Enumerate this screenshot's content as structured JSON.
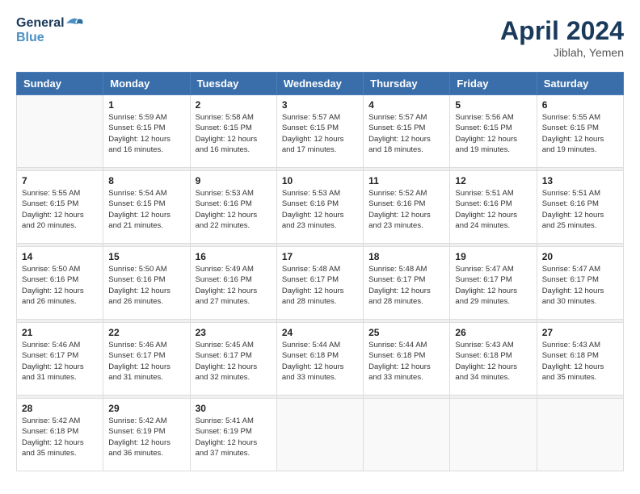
{
  "header": {
    "logo_line1": "General",
    "logo_line2": "Blue",
    "month": "April 2024",
    "location": "Jiblah, Yemen"
  },
  "weekdays": [
    "Sunday",
    "Monday",
    "Tuesday",
    "Wednesday",
    "Thursday",
    "Friday",
    "Saturday"
  ],
  "weeks": [
    [
      {
        "day": "",
        "sunrise": "",
        "sunset": "",
        "daylight": ""
      },
      {
        "day": "1",
        "sunrise": "Sunrise: 5:59 AM",
        "sunset": "Sunset: 6:15 PM",
        "daylight": "Daylight: 12 hours and 16 minutes."
      },
      {
        "day": "2",
        "sunrise": "Sunrise: 5:58 AM",
        "sunset": "Sunset: 6:15 PM",
        "daylight": "Daylight: 12 hours and 16 minutes."
      },
      {
        "day": "3",
        "sunrise": "Sunrise: 5:57 AM",
        "sunset": "Sunset: 6:15 PM",
        "daylight": "Daylight: 12 hours and 17 minutes."
      },
      {
        "day": "4",
        "sunrise": "Sunrise: 5:57 AM",
        "sunset": "Sunset: 6:15 PM",
        "daylight": "Daylight: 12 hours and 18 minutes."
      },
      {
        "day": "5",
        "sunrise": "Sunrise: 5:56 AM",
        "sunset": "Sunset: 6:15 PM",
        "daylight": "Daylight: 12 hours and 19 minutes."
      },
      {
        "day": "6",
        "sunrise": "Sunrise: 5:55 AM",
        "sunset": "Sunset: 6:15 PM",
        "daylight": "Daylight: 12 hours and 19 minutes."
      }
    ],
    [
      {
        "day": "7",
        "sunrise": "Sunrise: 5:55 AM",
        "sunset": "Sunset: 6:15 PM",
        "daylight": "Daylight: 12 hours and 20 minutes."
      },
      {
        "day": "8",
        "sunrise": "Sunrise: 5:54 AM",
        "sunset": "Sunset: 6:15 PM",
        "daylight": "Daylight: 12 hours and 21 minutes."
      },
      {
        "day": "9",
        "sunrise": "Sunrise: 5:53 AM",
        "sunset": "Sunset: 6:16 PM",
        "daylight": "Daylight: 12 hours and 22 minutes."
      },
      {
        "day": "10",
        "sunrise": "Sunrise: 5:53 AM",
        "sunset": "Sunset: 6:16 PM",
        "daylight": "Daylight: 12 hours and 23 minutes."
      },
      {
        "day": "11",
        "sunrise": "Sunrise: 5:52 AM",
        "sunset": "Sunset: 6:16 PM",
        "daylight": "Daylight: 12 hours and 23 minutes."
      },
      {
        "day": "12",
        "sunrise": "Sunrise: 5:51 AM",
        "sunset": "Sunset: 6:16 PM",
        "daylight": "Daylight: 12 hours and 24 minutes."
      },
      {
        "day": "13",
        "sunrise": "Sunrise: 5:51 AM",
        "sunset": "Sunset: 6:16 PM",
        "daylight": "Daylight: 12 hours and 25 minutes."
      }
    ],
    [
      {
        "day": "14",
        "sunrise": "Sunrise: 5:50 AM",
        "sunset": "Sunset: 6:16 PM",
        "daylight": "Daylight: 12 hours and 26 minutes."
      },
      {
        "day": "15",
        "sunrise": "Sunrise: 5:50 AM",
        "sunset": "Sunset: 6:16 PM",
        "daylight": "Daylight: 12 hours and 26 minutes."
      },
      {
        "day": "16",
        "sunrise": "Sunrise: 5:49 AM",
        "sunset": "Sunset: 6:16 PM",
        "daylight": "Daylight: 12 hours and 27 minutes."
      },
      {
        "day": "17",
        "sunrise": "Sunrise: 5:48 AM",
        "sunset": "Sunset: 6:17 PM",
        "daylight": "Daylight: 12 hours and 28 minutes."
      },
      {
        "day": "18",
        "sunrise": "Sunrise: 5:48 AM",
        "sunset": "Sunset: 6:17 PM",
        "daylight": "Daylight: 12 hours and 28 minutes."
      },
      {
        "day": "19",
        "sunrise": "Sunrise: 5:47 AM",
        "sunset": "Sunset: 6:17 PM",
        "daylight": "Daylight: 12 hours and 29 minutes."
      },
      {
        "day": "20",
        "sunrise": "Sunrise: 5:47 AM",
        "sunset": "Sunset: 6:17 PM",
        "daylight": "Daylight: 12 hours and 30 minutes."
      }
    ],
    [
      {
        "day": "21",
        "sunrise": "Sunrise: 5:46 AM",
        "sunset": "Sunset: 6:17 PM",
        "daylight": "Daylight: 12 hours and 31 minutes."
      },
      {
        "day": "22",
        "sunrise": "Sunrise: 5:46 AM",
        "sunset": "Sunset: 6:17 PM",
        "daylight": "Daylight: 12 hours and 31 minutes."
      },
      {
        "day": "23",
        "sunrise": "Sunrise: 5:45 AM",
        "sunset": "Sunset: 6:17 PM",
        "daylight": "Daylight: 12 hours and 32 minutes."
      },
      {
        "day": "24",
        "sunrise": "Sunrise: 5:44 AM",
        "sunset": "Sunset: 6:18 PM",
        "daylight": "Daylight: 12 hours and 33 minutes."
      },
      {
        "day": "25",
        "sunrise": "Sunrise: 5:44 AM",
        "sunset": "Sunset: 6:18 PM",
        "daylight": "Daylight: 12 hours and 33 minutes."
      },
      {
        "day": "26",
        "sunrise": "Sunrise: 5:43 AM",
        "sunset": "Sunset: 6:18 PM",
        "daylight": "Daylight: 12 hours and 34 minutes."
      },
      {
        "day": "27",
        "sunrise": "Sunrise: 5:43 AM",
        "sunset": "Sunset: 6:18 PM",
        "daylight": "Daylight: 12 hours and 35 minutes."
      }
    ],
    [
      {
        "day": "28",
        "sunrise": "Sunrise: 5:42 AM",
        "sunset": "Sunset: 6:18 PM",
        "daylight": "Daylight: 12 hours and 35 minutes."
      },
      {
        "day": "29",
        "sunrise": "Sunrise: 5:42 AM",
        "sunset": "Sunset: 6:19 PM",
        "daylight": "Daylight: 12 hours and 36 minutes."
      },
      {
        "day": "30",
        "sunrise": "Sunrise: 5:41 AM",
        "sunset": "Sunset: 6:19 PM",
        "daylight": "Daylight: 12 hours and 37 minutes."
      },
      {
        "day": "",
        "sunrise": "",
        "sunset": "",
        "daylight": ""
      },
      {
        "day": "",
        "sunrise": "",
        "sunset": "",
        "daylight": ""
      },
      {
        "day": "",
        "sunrise": "",
        "sunset": "",
        "daylight": ""
      },
      {
        "day": "",
        "sunrise": "",
        "sunset": "",
        "daylight": ""
      }
    ]
  ]
}
